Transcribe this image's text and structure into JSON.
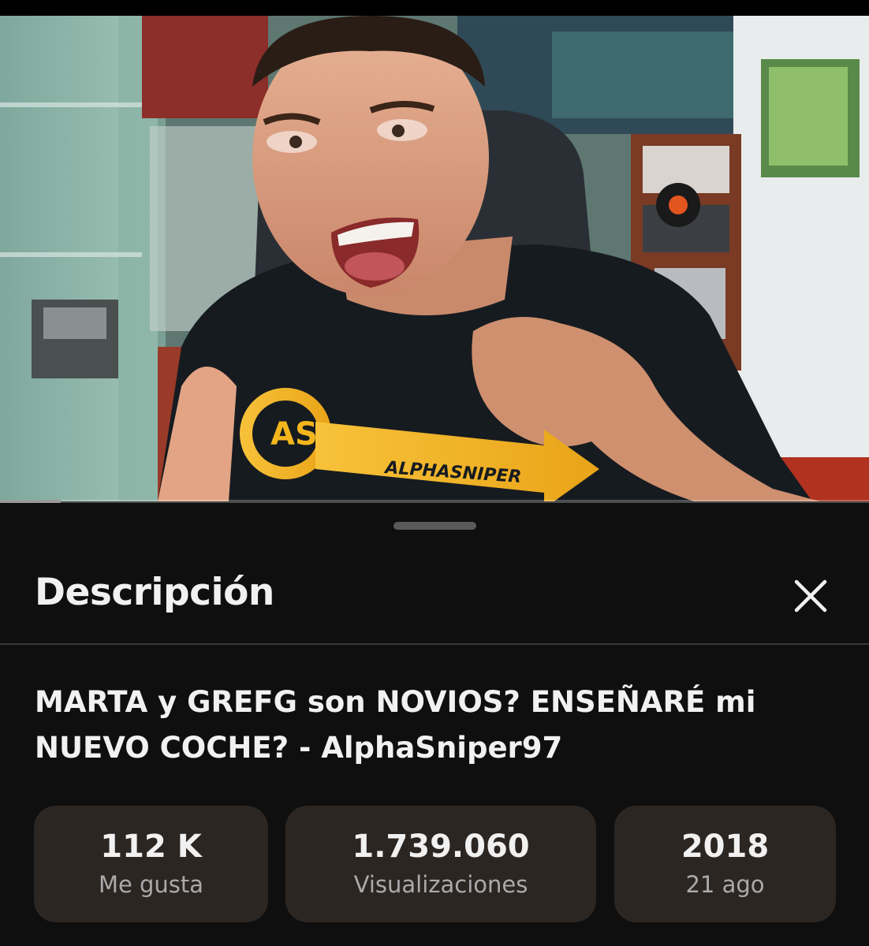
{
  "video": {
    "progress_fraction": 0.07,
    "shirt_text": "ALPHASNIPER",
    "shirt_logo": "AS"
  },
  "sheet": {
    "title": "Descripción",
    "close_icon": "close-icon",
    "video_title": "MARTA y GREFG son NOVIOS? ENSEÑARÉ mi NUEVO COCHE? - AlphaSniper97",
    "stats": [
      {
        "value": "112 K",
        "label": "Me gusta"
      },
      {
        "value": "1.739.060",
        "label": "Visualizaciones"
      },
      {
        "value": "2018",
        "label": "21 ago"
      }
    ]
  },
  "colors": {
    "background": "#0f0f0f",
    "card": "#2c2623",
    "muted_text": "#aaaaaa",
    "shirt_logo": "#f2b51c"
  }
}
